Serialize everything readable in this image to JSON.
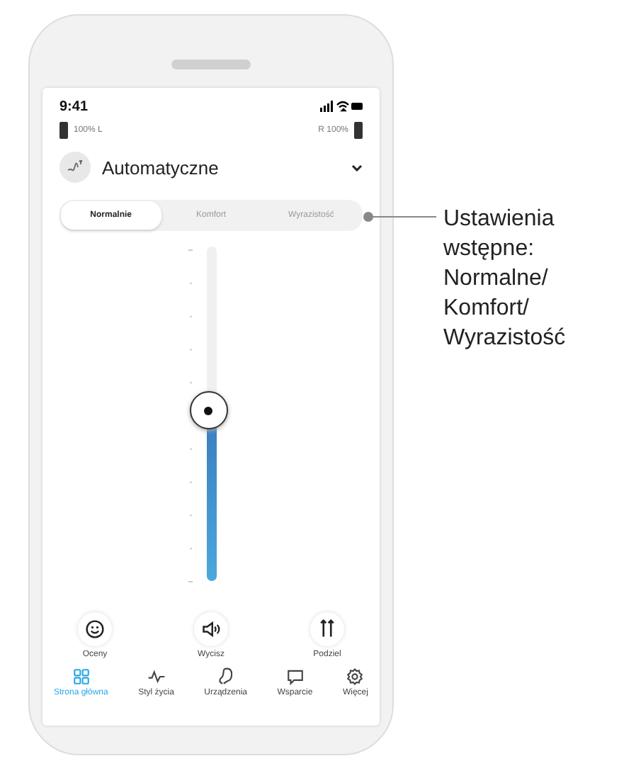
{
  "status_bar": {
    "time": "9:41"
  },
  "batteries": {
    "left": "100% L",
    "right": "R 100%"
  },
  "program": {
    "name": "Automatyczne"
  },
  "presets": [
    {
      "label": "Normalnie",
      "selected": true
    },
    {
      "label": "Komfort",
      "selected": false
    },
    {
      "label": "Wyrazistość",
      "selected": false
    }
  ],
  "volume": {
    "level": 0.51
  },
  "actions": [
    {
      "kind": "rate",
      "label": "Oceny"
    },
    {
      "kind": "mute",
      "label": "Wycisz"
    },
    {
      "kind": "split",
      "label": "Podziel"
    }
  ],
  "nav": [
    {
      "kind": "home",
      "label": "Strona główna",
      "selected": true
    },
    {
      "kind": "lifestyle",
      "label": "Styl życia",
      "selected": false
    },
    {
      "kind": "devices",
      "label": "Urządzenia",
      "selected": false
    },
    {
      "kind": "support",
      "label": "Wsparcie",
      "selected": false
    },
    {
      "kind": "more",
      "label": "Więcej",
      "selected": false
    }
  ],
  "callout": {
    "text": "Ustawienia wstępne: Normalne/ Komfort/ Wyrazistość"
  }
}
